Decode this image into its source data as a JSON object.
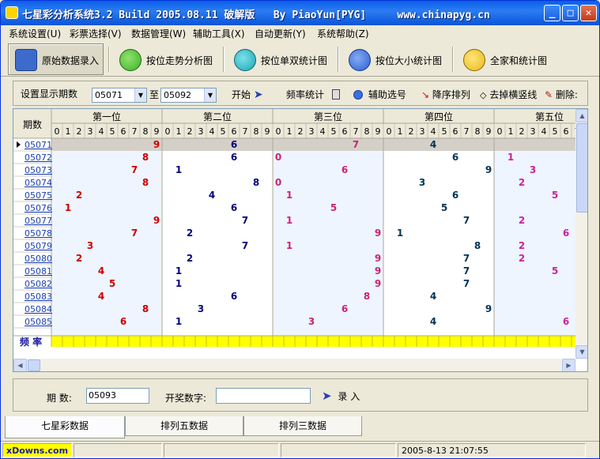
{
  "app": {
    "title": "七星彩分析系统3.2 Build 2005.08.11 破解版   By PiaoYun[PYG]     www.chinapyg.cn",
    "minimize": "_",
    "maximize": "□",
    "close": "✕"
  },
  "menu": [
    "系统设置(U)",
    "彩票选择(V)",
    "数据管理(W)",
    "辅助工具(X)",
    "自动更新(Y)",
    "系统帮助(Z)"
  ],
  "toolbar": [
    {
      "label": "原始数据录入",
      "icon": "data-entry-icon",
      "color": "#3d6bcc"
    },
    {
      "label": "按位走势分析图",
      "icon": "ladybug-green-icon",
      "color": "#3fae2a"
    },
    {
      "label": "按位单双统计图",
      "icon": "ladybug-teal-icon",
      "color": "#1aa7b5"
    },
    {
      "label": "按位大小统计图",
      "icon": "ladybug-blue-icon",
      "color": "#2b5fd1"
    },
    {
      "label": "全家和统计图",
      "icon": "ladybug-yellow-icon",
      "color": "#e8b818"
    }
  ],
  "settings": {
    "period_label": "设置显示期数",
    "from": "05071",
    "to_label": "至",
    "to": "05092",
    "start": "开始",
    "freq": "频率统计",
    "aux": "辅助选号",
    "desc": "降序排列",
    "remove_lines": "去掉横竖线",
    "delete": "删除:"
  },
  "grid": {
    "period_header": "期数",
    "groups": [
      "第一位",
      "第二位",
      "第三位",
      "第四位",
      "第五位"
    ],
    "digits": [
      "0",
      "1",
      "2",
      "3",
      "4",
      "5",
      "6",
      "7",
      "8",
      "9"
    ],
    "freq_label": "频 率",
    "group_colors": [
      "#cc0000",
      "#000080",
      "#cc2277",
      "#003355",
      "#cc2299"
    ],
    "rows": [
      {
        "period": "05071",
        "d": [
          9,
          6,
          7,
          4,
          null
        ]
      },
      {
        "period": "05072",
        "d": [
          8,
          6,
          0,
          6,
          1
        ]
      },
      {
        "period": "05073",
        "d": [
          7,
          1,
          6,
          9,
          3
        ]
      },
      {
        "period": "05074",
        "d": [
          8,
          8,
          0,
          3,
          2
        ]
      },
      {
        "period": "05075",
        "d": [
          2,
          4,
          1,
          6,
          5
        ]
      },
      {
        "period": "05076",
        "d": [
          1,
          6,
          5,
          5,
          null
        ]
      },
      {
        "period": "05077",
        "d": [
          9,
          7,
          1,
          7,
          2
        ]
      },
      {
        "period": "05078",
        "d": [
          7,
          2,
          9,
          1,
          6
        ]
      },
      {
        "period": "05079",
        "d": [
          3,
          7,
          1,
          8,
          2
        ]
      },
      {
        "period": "05080",
        "d": [
          2,
          2,
          9,
          7,
          2
        ]
      },
      {
        "period": "05081",
        "d": [
          4,
          1,
          9,
          7,
          5
        ]
      },
      {
        "period": "05082",
        "d": [
          5,
          1,
          9,
          7,
          null
        ]
      },
      {
        "period": "05083",
        "d": [
          4,
          6,
          8,
          4,
          null
        ]
      },
      {
        "period": "05084",
        "d": [
          8,
          3,
          6,
          9,
          null
        ]
      },
      {
        "period": "05085",
        "d": [
          6,
          1,
          3,
          4,
          6
        ]
      }
    ]
  },
  "entry": {
    "period_label": "期  数:",
    "period_value": "05093",
    "number_label": "开奖数字:",
    "number_value": "",
    "submit": "录  入"
  },
  "tabs": [
    "七星彩数据",
    "排列五数据",
    "排列三数据"
  ],
  "status": {
    "brand": "xDowns.com",
    "datetime": "2005-8-13  21:07:55"
  }
}
